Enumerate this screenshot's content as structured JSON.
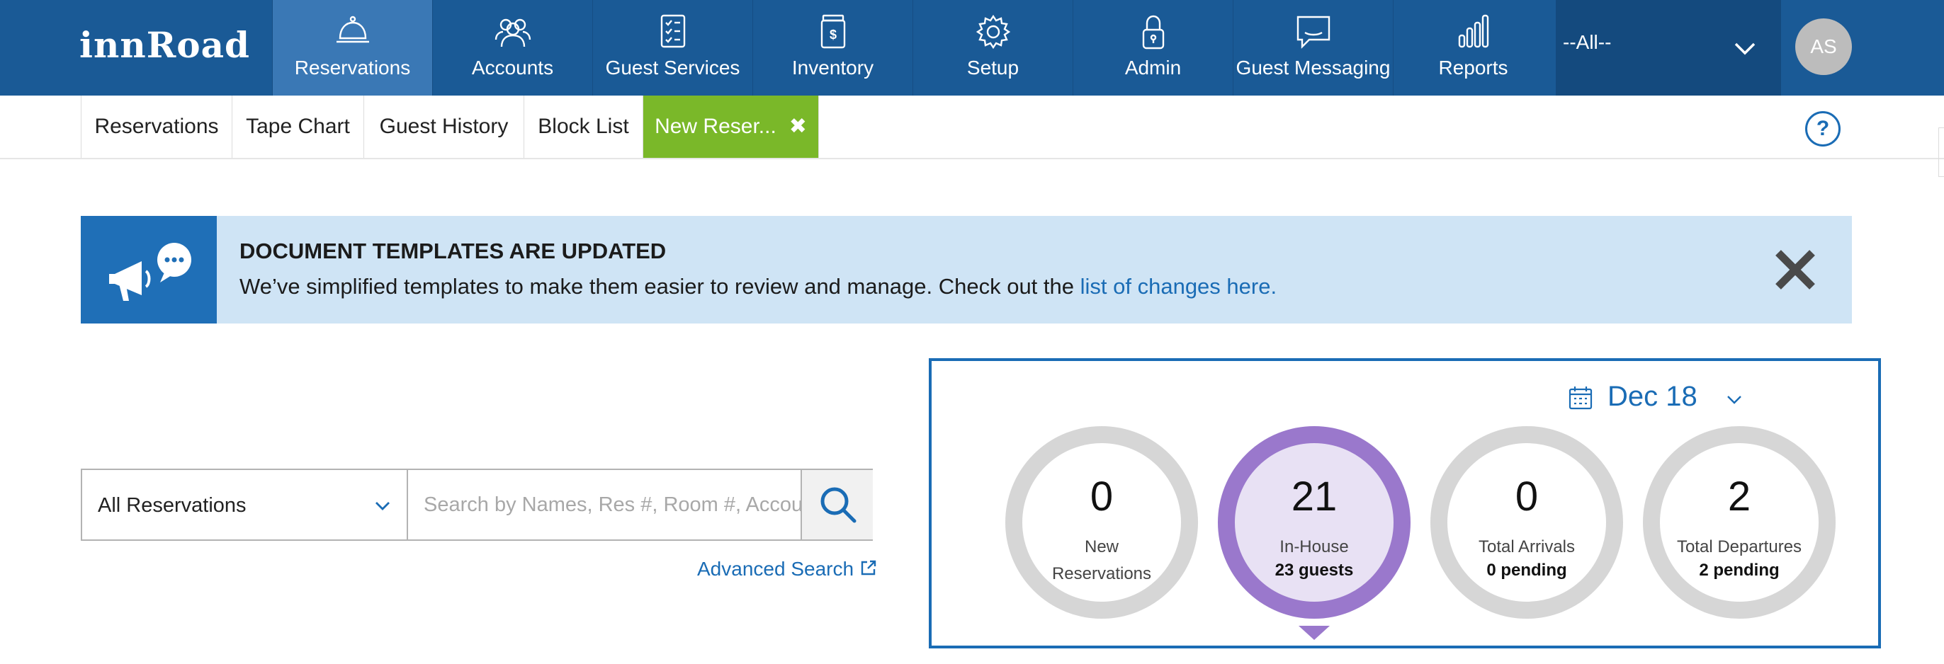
{
  "app": {
    "logo": "innRoad"
  },
  "nav": {
    "items": [
      {
        "label": "Reservations",
        "icon": "bell-icon",
        "active": true
      },
      {
        "label": "Accounts",
        "icon": "users-icon"
      },
      {
        "label": "Guest Services",
        "icon": "checklist-icon"
      },
      {
        "label": "Inventory",
        "icon": "inventory-jar-icon"
      },
      {
        "label": "Setup",
        "icon": "gear-icon"
      },
      {
        "label": "Admin",
        "icon": "lock-icon"
      },
      {
        "label": "Guest Messaging",
        "icon": "message-icon"
      },
      {
        "label": "Reports",
        "icon": "bar-chart-icon"
      }
    ],
    "property_select": "--All--",
    "avatar_initials": "AS"
  },
  "subtabs": {
    "items": [
      {
        "label": "Reservations"
      },
      {
        "label": "Tape Chart"
      },
      {
        "label": "Guest History"
      },
      {
        "label": "Block List"
      },
      {
        "label": "New Reser...",
        "active": true,
        "closable": true
      }
    ],
    "close_glyph": "✖",
    "help": "?"
  },
  "banner": {
    "title": "DOCUMENT TEMPLATES ARE UPDATED",
    "text": "We’ve simplified templates to make them easier to review and manage. Check out the ",
    "link": "list of changes here."
  },
  "search": {
    "filter_value": "All Reservations",
    "placeholder": "Search by Names, Res #, Room #, Account",
    "advanced_link": "Advanced Search"
  },
  "stats": {
    "date": "Dec 18",
    "cards": [
      {
        "number": "0",
        "label_line1": "New",
        "label_line2": "Reservations",
        "sub": ""
      },
      {
        "number": "21",
        "label_line1": "In-House",
        "label_line2": "",
        "sub": "23 guests",
        "active": true
      },
      {
        "number": "0",
        "label_line1": "Total Arrivals",
        "label_line2": "",
        "sub": "0 pending"
      },
      {
        "number": "2",
        "label_line1": "Total Departures",
        "label_line2": "",
        "sub": "2 pending"
      }
    ]
  },
  "colors": {
    "nav_bg": "#1a5a96",
    "nav_active": "#3a78b5",
    "tab_active": "#7ab829",
    "accent_blue": "#1a6cb5",
    "banner_bg": "#cfe4f5",
    "stat_ring": "#d6d6d6",
    "stat_active_ring": "#9a78cc",
    "stat_active_fill": "#e8e1f4"
  }
}
